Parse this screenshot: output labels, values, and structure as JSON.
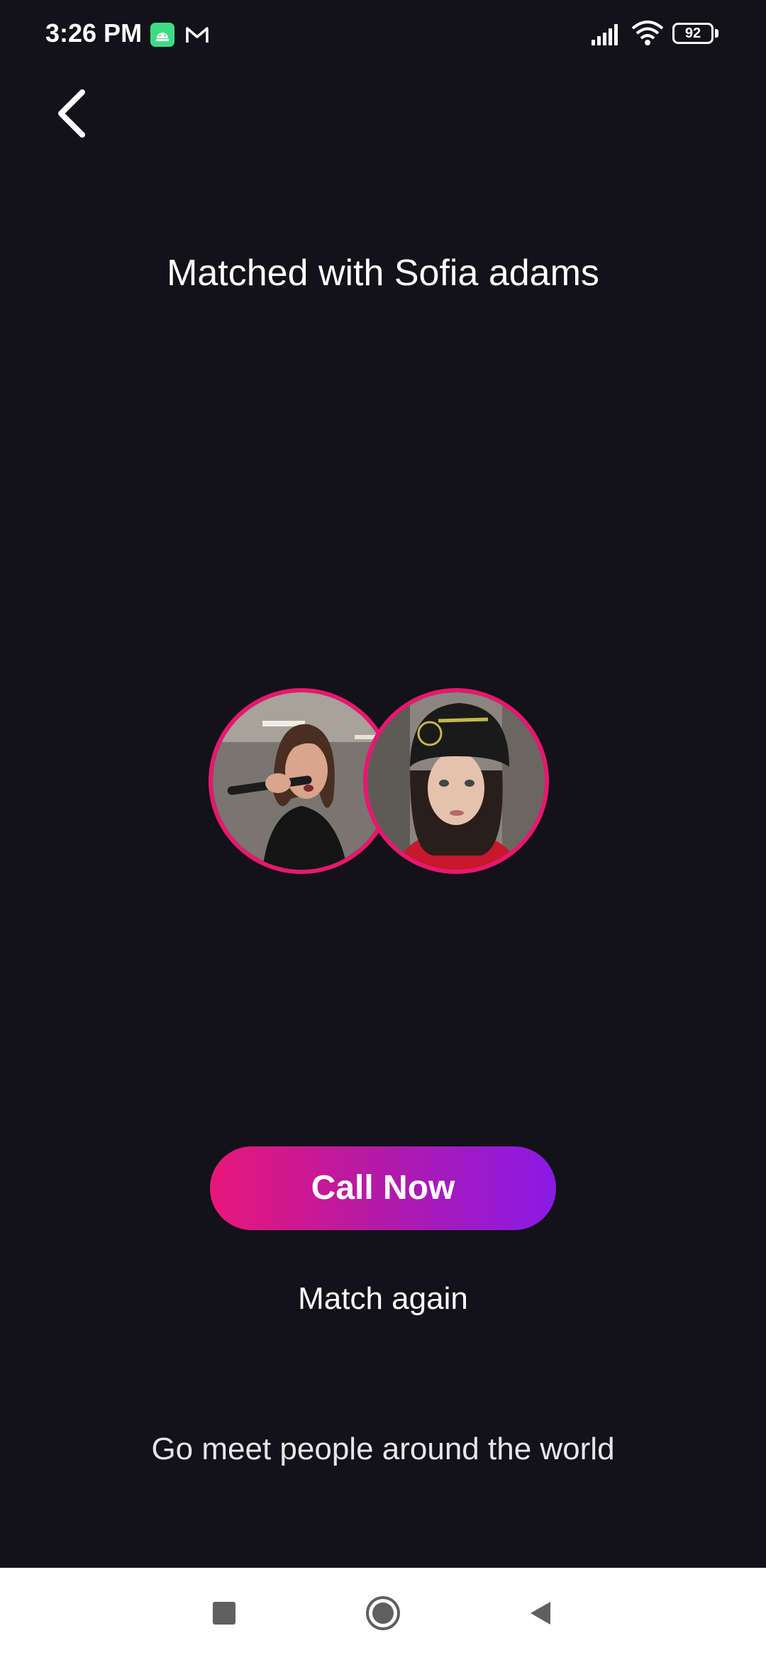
{
  "status_bar": {
    "time": "3:26 PM",
    "battery": "92",
    "notification_icons": [
      "android-icon",
      "gmail-icon"
    ],
    "system_icons": [
      "signal-icon",
      "wifi-icon",
      "battery-icon"
    ]
  },
  "header": {
    "back_icon": "chevron-left-icon",
    "title": "Matched with Sofia adams"
  },
  "avatars": [
    {
      "name": "user-avatar",
      "description_icon": "photo"
    },
    {
      "name": "match-avatar",
      "description_icon": "photo"
    }
  ],
  "actions": {
    "call_label": "Call Now",
    "match_again_label": "Match again"
  },
  "footer": {
    "tagline": "Go meet people around the world"
  },
  "nav_bar": {
    "icons": [
      "recents-square-icon",
      "home-circle-icon",
      "back-triangle-icon"
    ]
  },
  "colors": {
    "background": "#121218",
    "avatar_ring": "#e8176e",
    "gradient_start": "#e8177a",
    "gradient_end": "#8a1ae6",
    "nav_background": "#ffffff"
  }
}
